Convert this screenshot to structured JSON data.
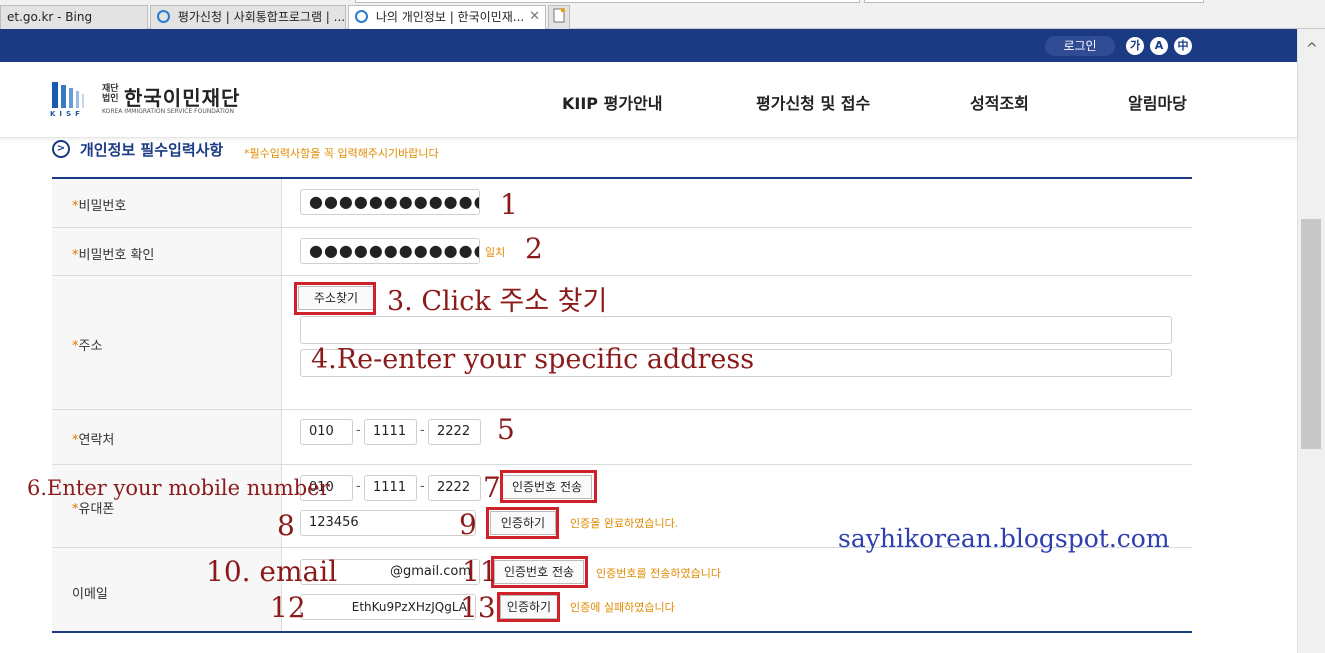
{
  "browser": {
    "tabs": [
      {
        "label": "et.go.kr - Bing"
      },
      {
        "label": "평가신청 | 사회통합프로그램 | ..."
      },
      {
        "label": "나의 개인정보 | 한국이민재...",
        "close": "✕"
      }
    ]
  },
  "topbar": {
    "login": "로그인",
    "font_buttons": [
      "가",
      "A",
      "中"
    ]
  },
  "logo": {
    "small": "재단\n법인",
    "name": "한국이민재단",
    "sub": "KOREA IMMIGRATION SERVICE FOUNDATION",
    "kisf": "KISF"
  },
  "nav": [
    "KIIP 평가안내",
    "평가신청 및 접수",
    "성적조회",
    "알림마당"
  ],
  "section": {
    "title": "개인정보 필수입력사항",
    "note": "*필수입력사항을 꼭 입력해주시기바랍니다"
  },
  "form": {
    "password_label": "비밀번호",
    "password_value": "●●●●●●●●●●●●",
    "password_confirm_label": "비밀번호 확인",
    "password_confirm_value": "●●●●●●●●●●●●",
    "password_match": "일치",
    "address_label": "주소",
    "address_button": "주소찾기",
    "contact_label": "연락처",
    "contact": [
      "010",
      "1111",
      "2222"
    ],
    "mobile_label": "유대폰",
    "mobile": [
      "010",
      "1111",
      "2222"
    ],
    "mobile_send_button": "인증번호 전송",
    "mobile_code": "123456",
    "mobile_verify_button": "인증하기",
    "mobile_status": "인증을 완료하였습니다.",
    "email_label": "이메일",
    "email_value": "@gmail.com",
    "email_send_button": "인증번호 전송",
    "email_send_status": "인증번호를 전송하였습니다",
    "email_code": "EthKu9PzXHzJQgLA",
    "email_verify_button": "인증하기",
    "email_status": "인증에 실패하였습니다",
    "dash": "-",
    "star": "*"
  },
  "annotations": {
    "n1": "1",
    "n2": "2",
    "n3": "3.",
    "n3_text": "Click 주소 찾기",
    "n4": "4.Re-enter your specific address",
    "n5": "5",
    "n6": "6.Enter your mobile number",
    "n7": "7",
    "n8": "8",
    "n9": "9",
    "n10": "10. email",
    "n11": "11",
    "n12": "12",
    "n13": "13"
  },
  "watermark": "sayhikorean.blogspot.com",
  "colors": {
    "navy": "#1a3a83",
    "annotation_red": "#8b1a1a",
    "highlight_box": "#d0202a",
    "status_orange": "#e08a00",
    "watermark_blue": "#2e3fb0"
  }
}
